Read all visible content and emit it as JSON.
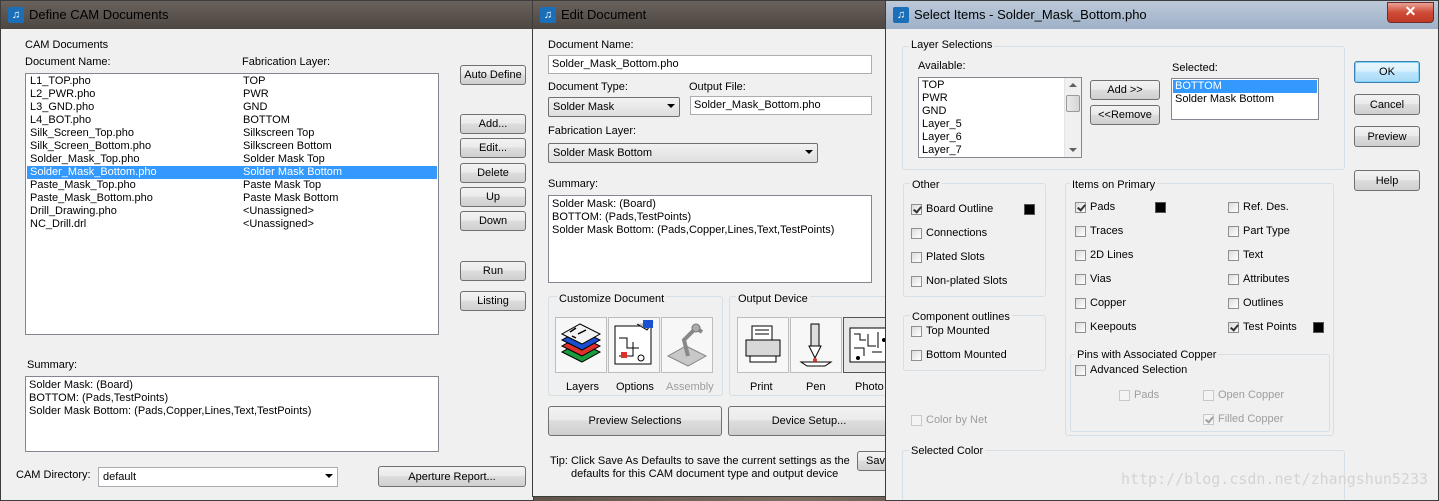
{
  "w1": {
    "title": "Define CAM Documents",
    "group_label": "CAM Documents",
    "col_name": "Document Name:",
    "col_layer": "Fabrication Layer:",
    "docs": [
      {
        "name": "L1_TOP.pho",
        "layer": "TOP"
      },
      {
        "name": "L2_PWR.pho",
        "layer": "PWR"
      },
      {
        "name": "L3_GND.pho",
        "layer": "GND"
      },
      {
        "name": "L4_BOT.pho",
        "layer": "BOTTOM"
      },
      {
        "name": "Silk_Screen_Top.pho",
        "layer": "Silkscreen Top"
      },
      {
        "name": "Silk_Screen_Bottom.pho",
        "layer": "Silkscreen Bottom"
      },
      {
        "name": "Solder_Mask_Top.pho",
        "layer": "Solder Mask Top"
      },
      {
        "name": "Solder_Mask_Bottom.pho",
        "layer": "Solder Mask Bottom"
      },
      {
        "name": "Paste_Mask_Top.pho",
        "layer": "Paste Mask Top"
      },
      {
        "name": "Paste_Mask_Bottom.pho",
        "layer": "Paste Mask Bottom"
      },
      {
        "name": "Drill_Drawing.pho",
        "layer": "<Unassigned>"
      },
      {
        "name": "NC_Drill.drl",
        "layer": "<Unassigned>"
      }
    ],
    "selected_index": 7,
    "buttons": {
      "auto_define": "Auto Define",
      "add": "Add...",
      "edit": "Edit...",
      "delete": "Delete",
      "up": "Up",
      "down": "Down",
      "run": "Run",
      "listing": "Listing"
    },
    "summary_label": "Summary:",
    "summary_lines": [
      "Solder Mask: (Board)",
      "BOTTOM: (Pads,TestPoints)",
      "Solder Mask Bottom: (Pads,Copper,Lines,Text,TestPoints)"
    ],
    "cam_dir_label": "CAM Directory:",
    "cam_dir_value": "default",
    "aperture_button": "Aperture Report..."
  },
  "w2": {
    "title": "Edit Document",
    "doc_name_label": "Document Name:",
    "doc_name_value": "Solder_Mask_Bottom.pho",
    "doc_type_label": "Document Type:",
    "doc_type_value": "Solder Mask",
    "output_file_label": "Output File:",
    "output_file_value": "Solder_Mask_Bottom.pho",
    "fab_layer_label": "Fabrication Layer:",
    "fab_layer_value": "Solder Mask Bottom",
    "summary_label": "Summary:",
    "summary_lines": [
      "Solder Mask: (Board)",
      "BOTTOM: (Pads,TestPoints)",
      "Solder Mask Bottom: (Pads,Copper,Lines,Text,TestPoints)"
    ],
    "customize_label": "Customize Document",
    "layers_label": "Layers",
    "options_label": "Options",
    "assembly_label": "Assembly",
    "output_device_label": "Output Device",
    "print_label": "Print",
    "pen_label": "Pen",
    "photo_label": "Photo",
    "preview_button": "Preview Selections",
    "device_setup_button": "Device Setup...",
    "save_button": "Save",
    "tip": "Tip: Click Save As Defaults to save the current settings as the",
    "tip2": "defaults for this CAM document type and output device"
  },
  "w3": {
    "title": "Select Items - Solder_Mask_Bottom.pho",
    "close": "✕",
    "layer_sel_label": "Layer Selections",
    "available_label": "Available:",
    "available": [
      "TOP",
      "PWR",
      "GND",
      "Layer_5",
      "Layer_6",
      "Layer_7"
    ],
    "selected_label": "Selected:",
    "selected": [
      "BOTTOM",
      "Solder Mask Bottom"
    ],
    "add_button": "Add >>",
    "remove_button": "<<Remove",
    "ok": "OK",
    "cancel": "Cancel",
    "preview": "Preview",
    "help": "Help",
    "other_label": "Other",
    "other": [
      {
        "label": "Board Outline",
        "checked": true,
        "color": "#000000"
      },
      {
        "label": "Connections",
        "checked": false
      },
      {
        "label": "Plated Slots",
        "checked": false
      },
      {
        "label": "Non-plated Slots",
        "checked": false
      }
    ],
    "component_label": "Component outlines",
    "component": [
      {
        "label": "Top Mounted",
        "checked": false
      },
      {
        "label": "Bottom Mounted",
        "checked": false
      }
    ],
    "color_by_net": "Color by Net",
    "items_label": "Items on Primary",
    "items_left": [
      {
        "label": "Pads",
        "checked": true,
        "color": "#000000"
      },
      {
        "label": "Traces",
        "checked": false
      },
      {
        "label": "2D Lines",
        "checked": false
      },
      {
        "label": "Vias",
        "checked": false
      },
      {
        "label": "Copper",
        "checked": false
      },
      {
        "label": "Keepouts",
        "checked": false
      }
    ],
    "items_right": [
      {
        "label": "Ref. Des.",
        "checked": false
      },
      {
        "label": "Part Type",
        "checked": false
      },
      {
        "label": "Text",
        "checked": false
      },
      {
        "label": "Attributes",
        "checked": false
      },
      {
        "label": "Outlines",
        "checked": false
      },
      {
        "label": "Test Points",
        "checked": true,
        "color": "#000000"
      }
    ],
    "pins_label": "Pins with Associated Copper",
    "advanced": "Advanced Selection",
    "pins_pads": "Pads",
    "open_copper": "Open Copper",
    "filled_copper": "Filled Copper",
    "selected_color_label": "Selected Color"
  },
  "watermark": "http://blog.csdn.net/zhangshun5233"
}
